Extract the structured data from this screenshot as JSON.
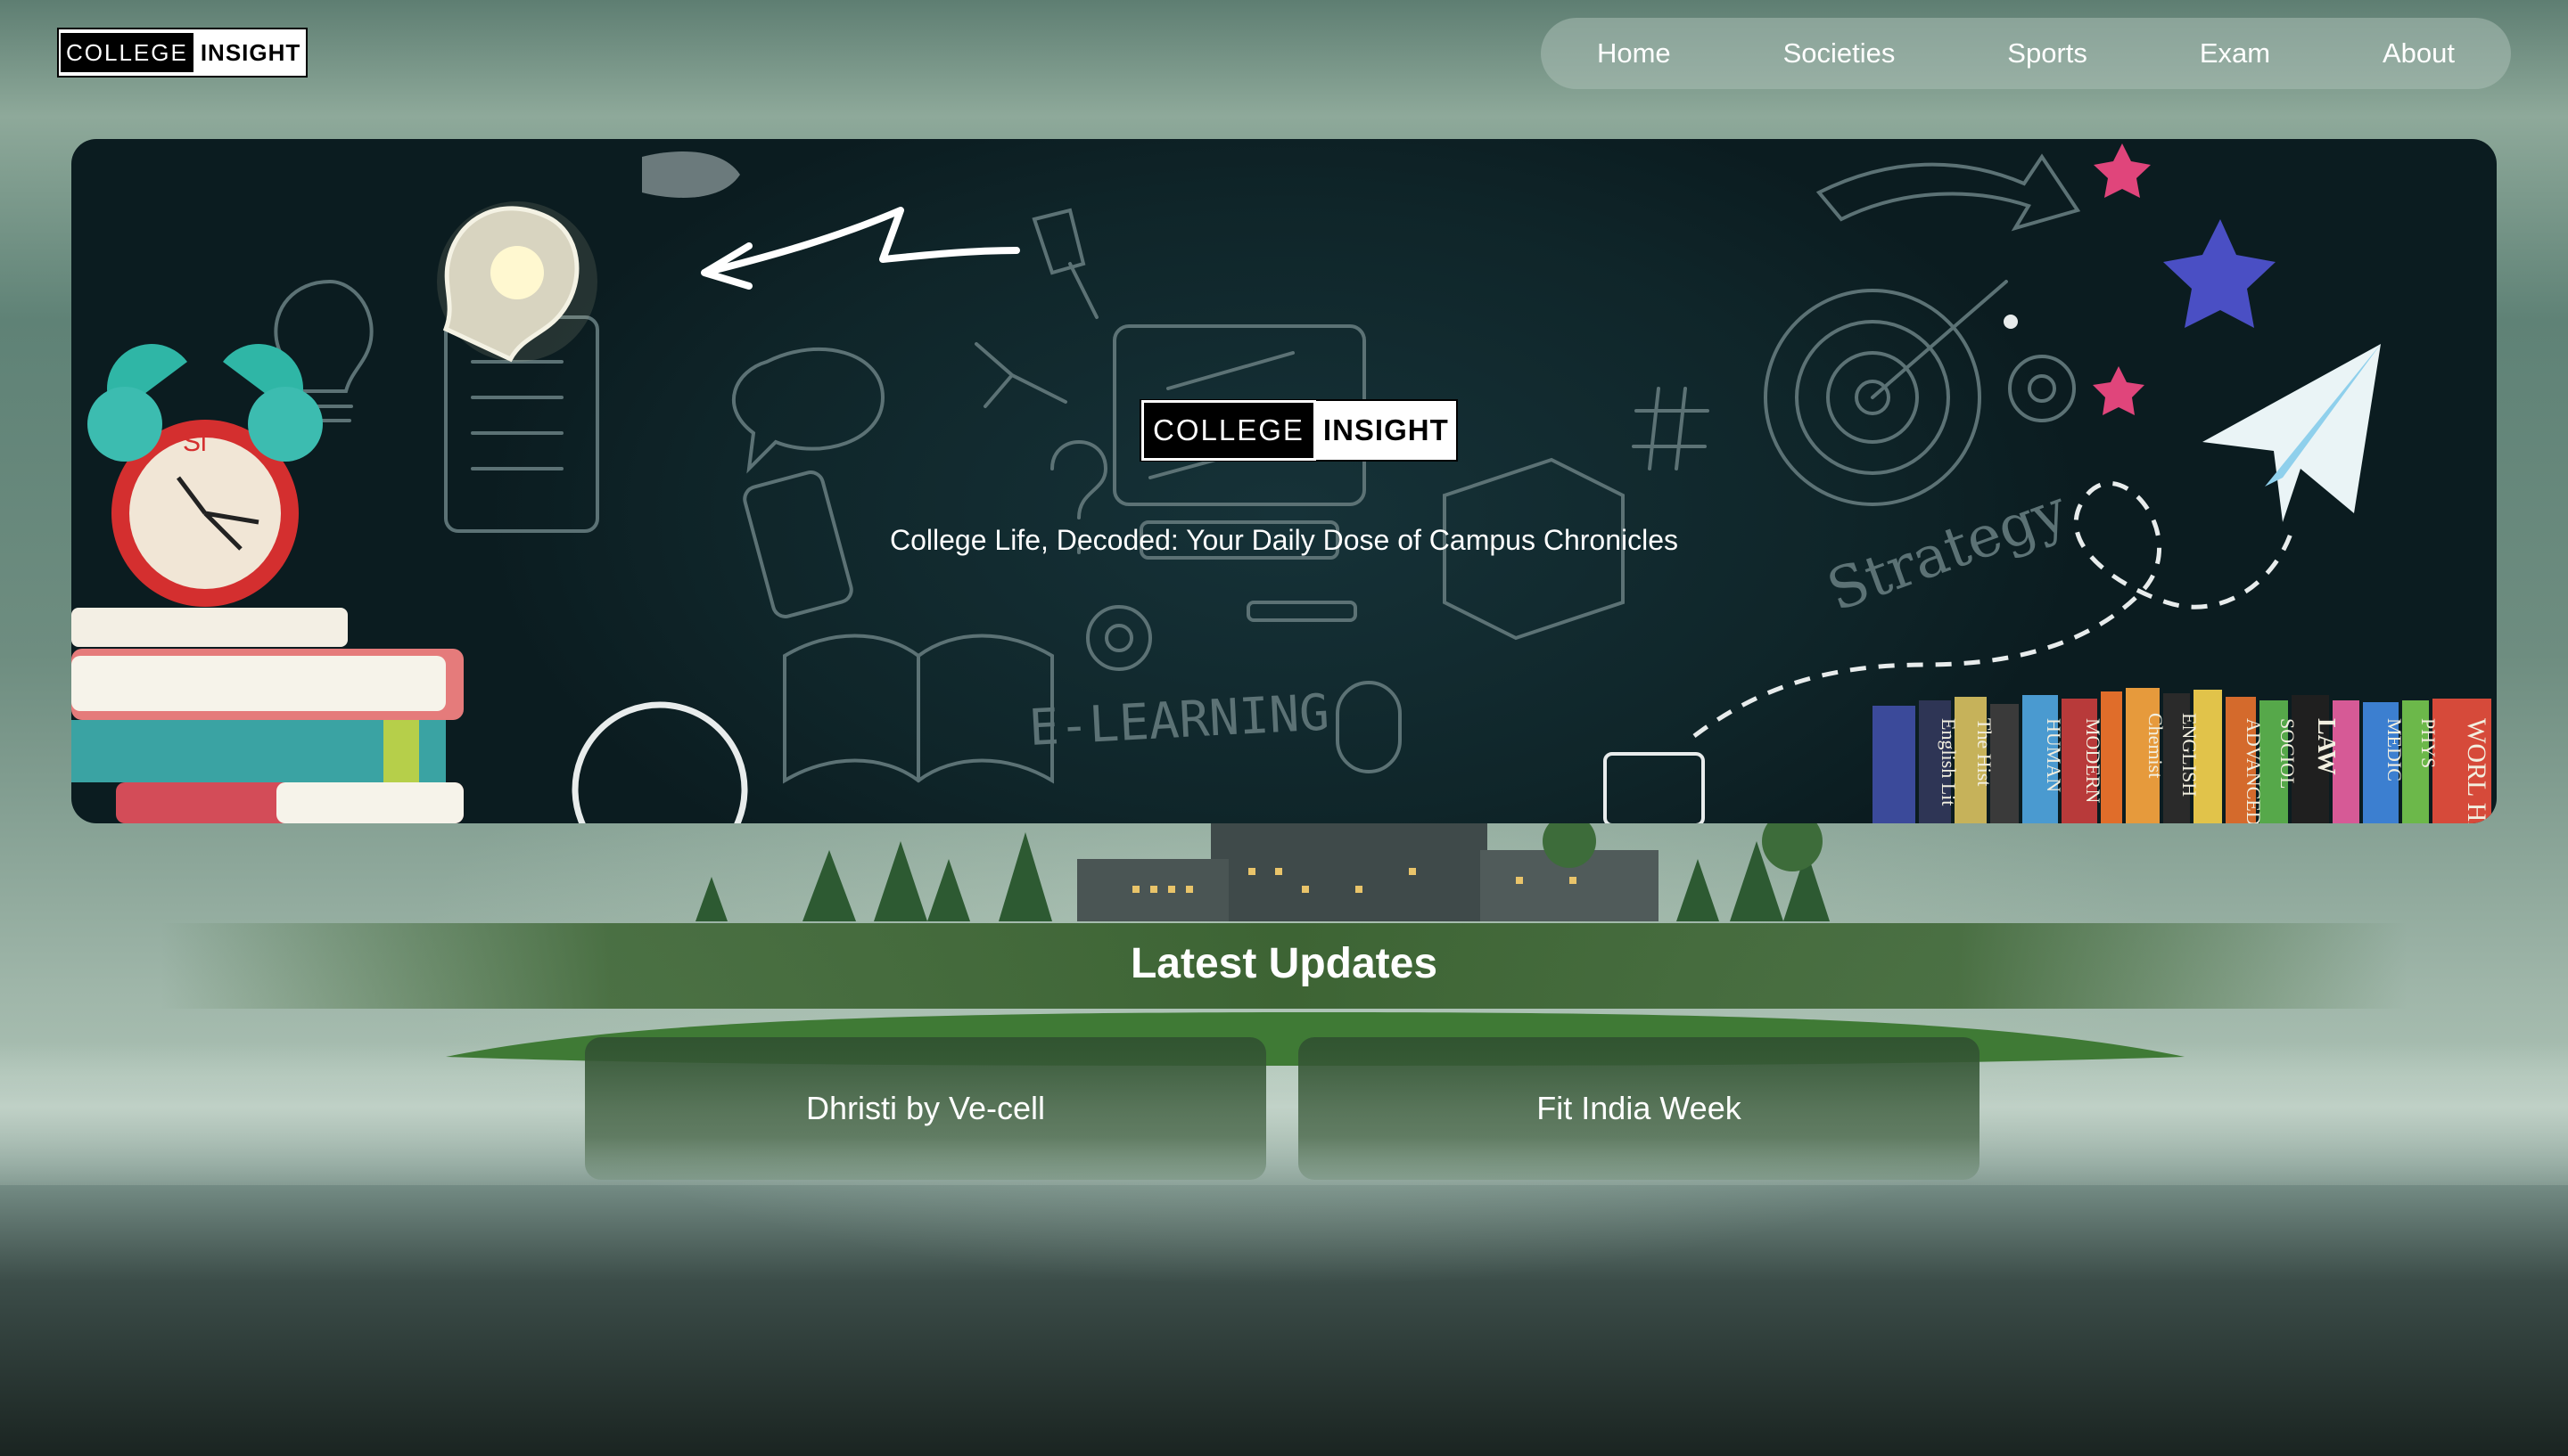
{
  "brand": {
    "word1": "COLLEGE",
    "word2": "INSIGHT"
  },
  "nav": {
    "items": [
      "Home",
      "Societies",
      "Sports",
      "Exam",
      "About"
    ]
  },
  "hero": {
    "tagline": "College Life, Decoded: Your Daily Dose of Campus Chronicles",
    "doodle_text": {
      "elearning": "E-LEARNING",
      "strategy": "Strategy"
    },
    "book_spines": [
      "English Lit",
      "The Hist",
      "HUMAN",
      "MODERN",
      "Chemist",
      "ENGLISH",
      "ADVANCED",
      "SOCIOL",
      "LAW",
      "MEDIC",
      "PHYS",
      "WORL HISTO"
    ]
  },
  "updates": {
    "title": "Latest Updates",
    "cards": [
      "Dhristi by Ve-cell",
      "Fit India Week"
    ]
  },
  "colors": {
    "hero_bg": "#0f2529",
    "band_green": "#3d6a35",
    "accent_pink": "#e0457b",
    "accent_blue": "#4a4fc4"
  }
}
